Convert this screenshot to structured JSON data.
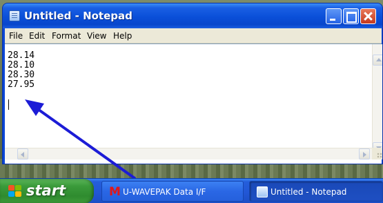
{
  "window": {
    "title": "Untitled - Notepad"
  },
  "menu": {
    "file": "File",
    "edit": "Edit",
    "format": "Format",
    "view": "View",
    "help": "Help"
  },
  "document": {
    "lines": [
      "28.14",
      "28.10",
      "28.30",
      "27.95"
    ]
  },
  "annotation": {
    "arrow_color": "#1c1cd6"
  },
  "taskbar": {
    "start_label": "start",
    "tasks": [
      {
        "label": "U-WAVEPAK Data I/F",
        "icon": "m-app-icon"
      },
      {
        "label": "Untitled - Notepad",
        "icon": "notepad-icon"
      }
    ]
  }
}
